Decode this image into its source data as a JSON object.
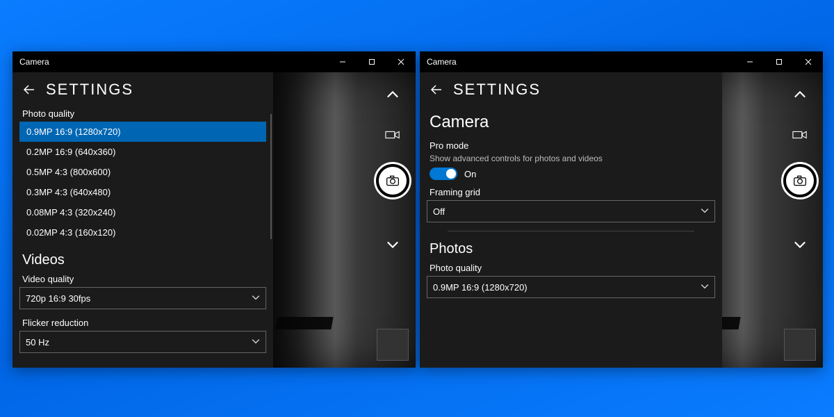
{
  "window": {
    "title": "Camera"
  },
  "settings_title": "SETTINGS",
  "left": {
    "photo_quality_label": "Photo quality",
    "photo_options": {
      "o0": "0.9MP 16:9 (1280x720)",
      "o1": "0.2MP 16:9 (640x360)",
      "o2": "0.5MP 4:3 (800x600)",
      "o3": "0.3MP 4:3 (640x480)",
      "o4": "0.08MP 4:3 (320x240)",
      "o5": "0.02MP 4:3 (160x120)"
    },
    "videos_heading": "Videos",
    "video_quality_label": "Video quality",
    "video_quality_value": "720p 16:9 30fps",
    "flicker_label": "Flicker reduction",
    "flicker_value": "50 Hz"
  },
  "right": {
    "camera_heading": "Camera",
    "pro_mode_label": "Pro mode",
    "pro_mode_desc": "Show advanced controls for photos and videos",
    "pro_mode_state": "On",
    "framing_grid_label": "Framing grid",
    "framing_grid_value": "Off",
    "photos_heading": "Photos",
    "photo_quality_label": "Photo quality",
    "photo_quality_value": "0.9MP 16:9 (1280x720)"
  }
}
